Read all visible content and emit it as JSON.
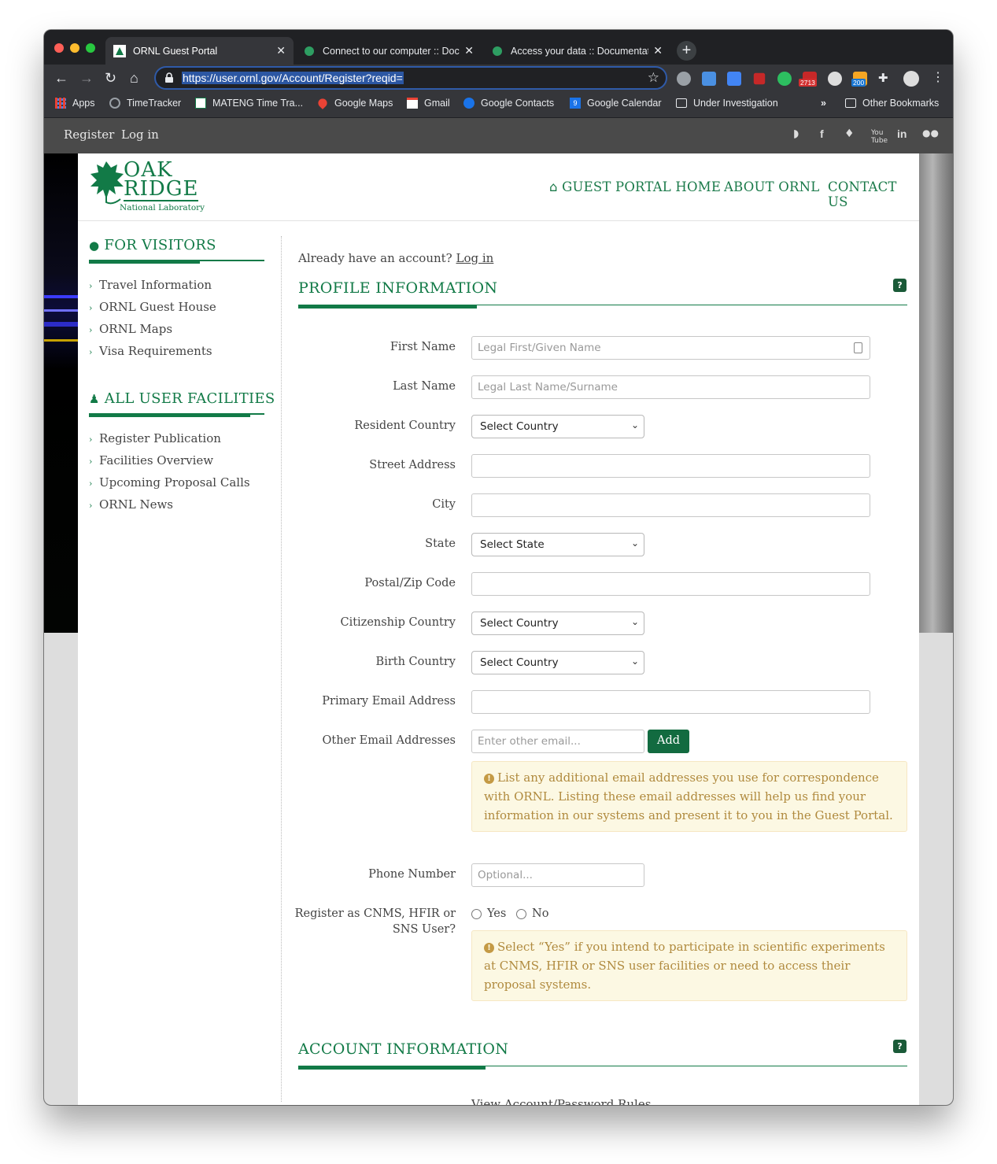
{
  "browser": {
    "tabs": [
      {
        "title": "ORNL Guest Portal",
        "active": true
      },
      {
        "title": "Connect to our computer :: Documentation",
        "active": false
      },
      {
        "title": "Access your data :: Documentation",
        "active": false
      }
    ],
    "url": "https://user.ornl.gov/Account/Register?reqid=",
    "ext_badges": [
      "2713",
      "200"
    ],
    "bookmarks": [
      "Apps",
      "TimeTracker",
      "MATENG Time Tra...",
      "Google Maps",
      "Gmail",
      "Google Contacts",
      "Google Calendar",
      "Under Investigation"
    ],
    "bookmarks_overflow": "»",
    "other_bookmarks": "Other Bookmarks",
    "calendar_day": "9"
  },
  "topbar": {
    "register": "Register",
    "login": "Log in"
  },
  "logo": {
    "line1": "OAK",
    "line2": "RIDGE",
    "line3": "National Laboratory"
  },
  "nav": {
    "home": "GUEST PORTAL HOME",
    "about": "ABOUT ORNL",
    "contact": "CONTACT US"
  },
  "sidebar": {
    "visitors_title": "FOR VISITORS",
    "visitors_items": [
      "Travel Information",
      "ORNL Guest House",
      "ORNL Maps",
      "Visa Requirements"
    ],
    "facilities_title": "ALL USER FACILITIES",
    "facilities_items": [
      "Register Publication",
      "Facilities Overview",
      "Upcoming Proposal Calls",
      "ORNL News"
    ]
  },
  "form": {
    "already_text": "Already have an account?",
    "already_link": "Log in",
    "profile_title": "PROFILE INFORMATION",
    "account_title": "ACCOUNT INFORMATION",
    "help_glyph": "?",
    "labels": {
      "first_name": "First Name",
      "last_name": "Last Name",
      "resident_country": "Resident Country",
      "street": "Street Address",
      "city": "City",
      "state": "State",
      "postal": "Postal/Zip Code",
      "citizenship": "Citizenship Country",
      "birth_country": "Birth Country",
      "primary_email": "Primary Email Address",
      "other_emails": "Other Email Addresses",
      "phone": "Phone Number",
      "register_as_1": "Register as CNMS, HFIR or",
      "register_as_2": "SNS User?"
    },
    "placeholders": {
      "first_name": "Legal First/Given Name",
      "last_name": "Legal Last Name/Surname",
      "other_email": "Enter other email...",
      "phone": "Optional..."
    },
    "selects": {
      "resident_country": "Select Country",
      "state": "Select State",
      "citizenship": "Select Country",
      "birth_country": "Select Country"
    },
    "add_button": "Add",
    "email_note": "List any additional email addresses you use for correspondence with ORNL. Listing these email addresses will help us find your information in our systems and present it to you in the Guest Portal.",
    "radio_yes": "Yes",
    "radio_no": "No",
    "user_note": "Select “Yes” if you intend to participate in scientific experiments at CNMS, HFIR or SNS user facilities or need to access their proposal systems.",
    "account_rules_link": "View Account/Password Rules"
  },
  "colors": {
    "brand_green": "#127a47",
    "button_green": "#126b40",
    "note_bg": "#fcf8e3",
    "note_text": "#b08a3e"
  }
}
